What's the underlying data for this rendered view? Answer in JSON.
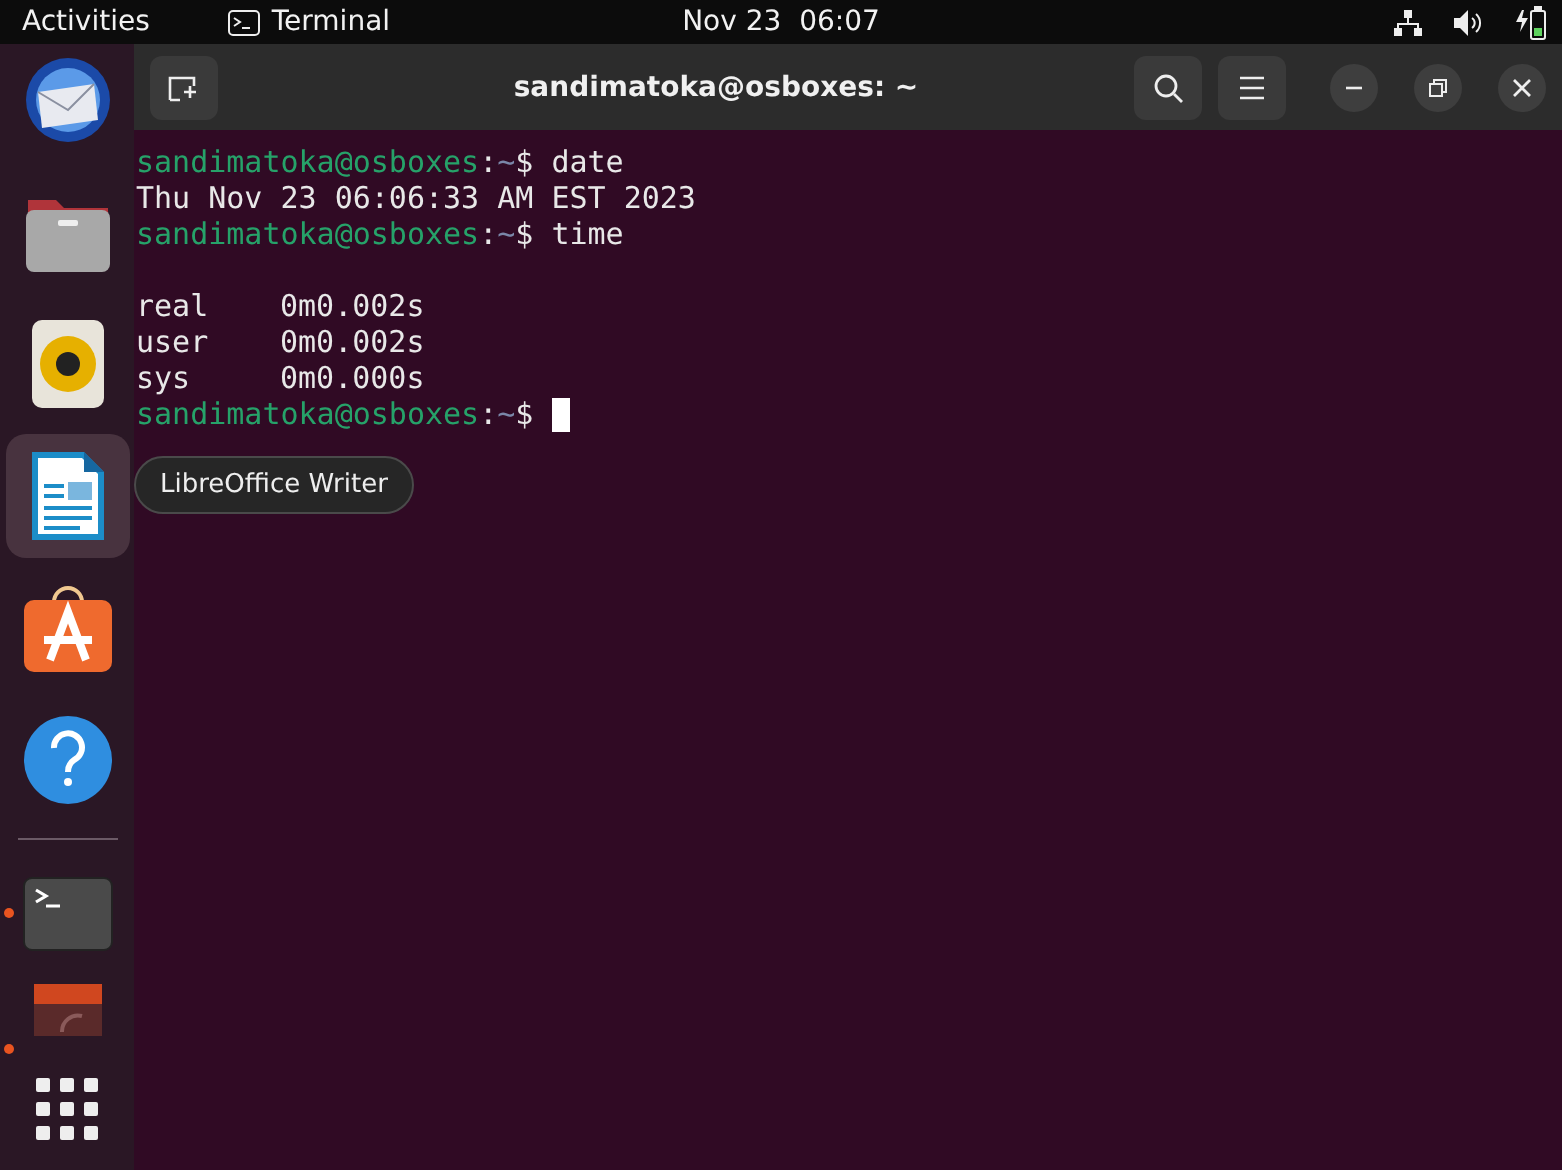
{
  "top_bar": {
    "activities": "Activities",
    "app_menu": "Terminal",
    "clock": "Nov 23  06:07"
  },
  "dock": {
    "pinned": [
      {
        "kind": "mail",
        "running": false,
        "hovered": false
      },
      {
        "kind": "files",
        "running": false,
        "hovered": false
      },
      {
        "kind": "music",
        "running": false,
        "hovered": false
      },
      {
        "kind": "writer",
        "running": false,
        "hovered": true
      },
      {
        "kind": "store",
        "running": false,
        "hovered": false
      },
      {
        "kind": "help",
        "running": false,
        "hovered": false
      }
    ],
    "running": [
      {
        "kind": "terminal",
        "running": true,
        "hovered": false
      },
      {
        "kind": "partial",
        "running": true,
        "hovered": false
      }
    ],
    "tooltip": "LibreOffice Writer"
  },
  "window": {
    "title": "sandimatoka@osboxes: ~"
  },
  "terminal": {
    "lines": [
      {
        "kind": "prompt",
        "user": "sandimatoka@osboxes",
        "sep": ":",
        "path": "~",
        "sigil": "$",
        "command": "date"
      },
      {
        "kind": "output",
        "text": "Thu Nov 23 06:06:33 AM EST 2023"
      },
      {
        "kind": "prompt",
        "user": "sandimatoka@osboxes",
        "sep": ":",
        "path": "~",
        "sigil": "$",
        "command": "time"
      },
      {
        "kind": "blank"
      },
      {
        "kind": "timing",
        "label": "real",
        "value": "0m0.002s"
      },
      {
        "kind": "timing",
        "label": "user",
        "value": "0m0.002s"
      },
      {
        "kind": "timing",
        "label": "sys",
        "value": "0m0.000s"
      },
      {
        "kind": "prompt",
        "user": "sandimatoka@osboxes",
        "sep": ":",
        "path": "~",
        "sigil": "$",
        "cursor": true
      }
    ]
  }
}
